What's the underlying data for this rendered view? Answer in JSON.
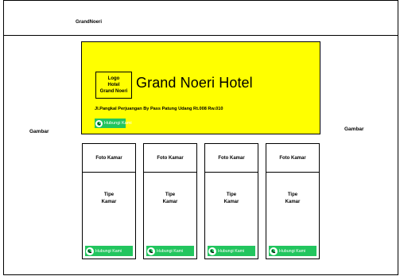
{
  "header": {
    "brand": "GrandNoeri"
  },
  "sides": {
    "left_label": "Gambar",
    "right_label": "Gambar"
  },
  "hero": {
    "logo_lines": [
      "Logo",
      "Hotel",
      "Grand Noeri"
    ],
    "title": "Grand Noeri Hotel",
    "address": "Jl.Pangkal Perjuangan By Pass Patung Udang Rt.008 Rw.010",
    "contact_label": "Hubungi Kami",
    "background": "#ffff00"
  },
  "rooms": [
    {
      "photo_label": "Foto Kamar",
      "type_line1": "Tipe",
      "type_line2": "Kamar",
      "contact_label": "Hubungi Kami"
    },
    {
      "photo_label": "Foto Kamar",
      "type_line1": "Tipe",
      "type_line2": "Kamar",
      "contact_label": "Hubungi Kami"
    },
    {
      "photo_label": "Foto Kamar",
      "type_line1": "Tipe",
      "type_line2": "Kamar",
      "contact_label": "Hubungi Kami"
    },
    {
      "photo_label": "Foto Kamar",
      "type_line1": "Tipe",
      "type_line2": "Kamar",
      "contact_label": "Hubungi Kami"
    }
  ],
  "colors": {
    "contact_button": "#22c55e"
  },
  "icons": {
    "contact": "whatsapp-icon"
  }
}
